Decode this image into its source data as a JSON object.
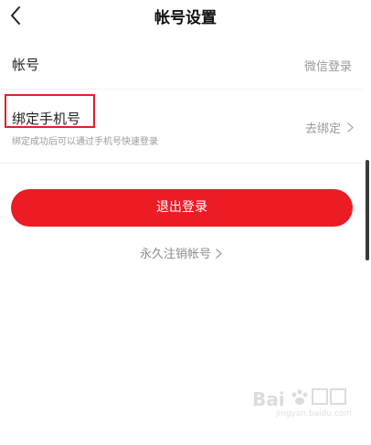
{
  "header": {
    "title": "帐号设置"
  },
  "account": {
    "label": "帐号",
    "value": "微信登录"
  },
  "phone": {
    "label": "绑定手机号",
    "subtitle": "绑定成功后可以通过手机号快速登录",
    "value": "去绑定"
  },
  "actions": {
    "logout_label": "退出登录",
    "delete_label": "永久注销帐号"
  },
  "watermark": {
    "text": "jingyan.baidu.com"
  },
  "colors": {
    "accent": "#ec1c24",
    "highlight_border": "#d9232b",
    "secondary_text": "#9a9a9a"
  },
  "icons": {
    "back": "chevron-left-icon",
    "row_arrow": "chevron-right-icon"
  }
}
